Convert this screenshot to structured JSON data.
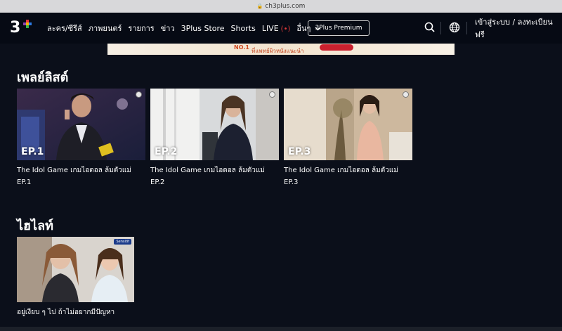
{
  "browser": {
    "url": "ch3plus.com"
  },
  "header": {
    "logo_text": "3",
    "nav": [
      {
        "label": "ละคร/ซีรีส์"
      },
      {
        "label": "ภาพยนตร์"
      },
      {
        "label": "รายการ"
      },
      {
        "label": "ข่าว"
      },
      {
        "label": "3Plus Store"
      },
      {
        "label": "Shorts"
      },
      {
        "label": "LIVE"
      },
      {
        "label": "อื่นๆ"
      }
    ],
    "live_indicator": "(•)",
    "more_chevron": "⌄",
    "premium_button": "3Plus Premium",
    "login_label": "เข้าสู่ระบบ / ลงทะเบียนฟรี",
    "icons": [
      "search-icon",
      "globe-icon"
    ]
  },
  "banner": {
    "text_main": "NO.1",
    "text_sub": "ที่แพทย์ผิวหนังแนะนำ"
  },
  "playlist": {
    "title": "เพลย์ลิสต์",
    "items": [
      {
        "episode": "EP.1",
        "title_line1": "The Idol Game เกมไอดอล ล้มตัวแม่",
        "title_line2": "EP.1"
      },
      {
        "episode": "EP.2",
        "title_line1": "The Idol Game เกมไอดอล ล้มตัวแม่",
        "title_line2": "EP.2"
      },
      {
        "episode": "EP.3",
        "title_line1": "The Idol Game เกมไอดอล ล้มตัวแม่",
        "title_line2": "EP.3"
      }
    ]
  },
  "highlight": {
    "title": "ไฮไลท์",
    "items": [
      {
        "title": "อยู่เงียบ ๆ ไป ถ้าไม่อยากมีปัญหา",
        "badge": "Sensitif"
      }
    ]
  },
  "colors": {
    "background": "#0b0f1a",
    "nav_bg": "#060a14",
    "live_red": "#e53b3b"
  }
}
